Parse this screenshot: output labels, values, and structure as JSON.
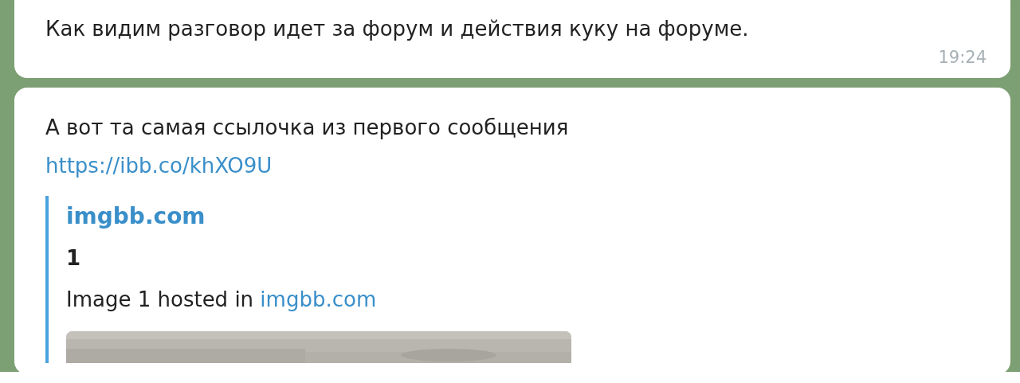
{
  "messages": [
    {
      "text": "Как видим разговор идет за форум и действия куку на форуме.",
      "time": "19:24"
    },
    {
      "text": "А вот та самая ссылочка из первого сообщения",
      "link": "https://ibb.co/khXO9U",
      "preview": {
        "site": "imgbb.com",
        "title": "1",
        "description": "Image 1 hosted in",
        "description_link": "imgbb.com"
      }
    }
  ]
}
